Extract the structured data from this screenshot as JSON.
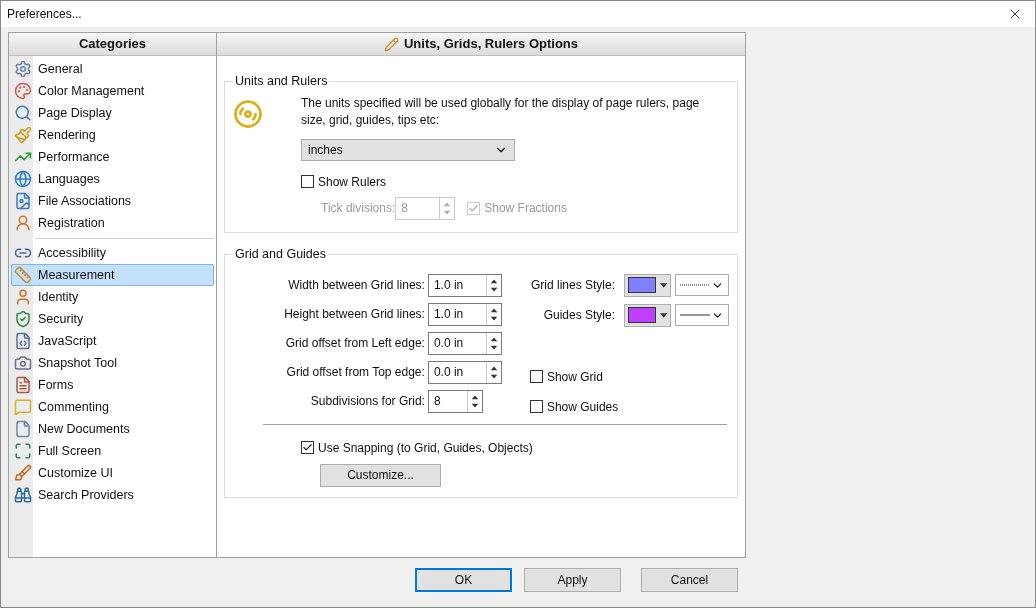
{
  "window": {
    "title": "Preferences..."
  },
  "categories": {
    "title": "Categories",
    "groups": [
      [
        {
          "label": "General",
          "selected": false
        },
        {
          "label": "Color Management",
          "selected": false
        },
        {
          "label": "Page Display",
          "selected": false
        },
        {
          "label": "Rendering",
          "selected": false
        },
        {
          "label": "Performance",
          "selected": false
        },
        {
          "label": "Languages",
          "selected": false
        },
        {
          "label": "File Associations",
          "selected": false
        },
        {
          "label": "Registration",
          "selected": false
        }
      ],
      [
        {
          "label": "Accessibility",
          "selected": false
        },
        {
          "label": "Measurement",
          "selected": true
        },
        {
          "label": "Identity",
          "selected": false
        },
        {
          "label": "Security",
          "selected": false
        },
        {
          "label": "JavaScript",
          "selected": false
        },
        {
          "label": "Snapshot Tool",
          "selected": false
        },
        {
          "label": "Forms",
          "selected": false
        },
        {
          "label": "Commenting",
          "selected": false
        },
        {
          "label": "New Documents",
          "selected": false
        },
        {
          "label": "Full Screen",
          "selected": false
        },
        {
          "label": "Customize UI",
          "selected": false
        },
        {
          "label": "Search Providers",
          "selected": false
        }
      ]
    ]
  },
  "panel": {
    "title": "Units, Grids, Rulers Options"
  },
  "units_and_rulers": {
    "title": "Units and Rulers",
    "description": "The units specified will be used globally for the display of page rulers, page size, grid, guides, tips etc:",
    "units_dropdown": {
      "value": "inches"
    },
    "show_rulers": {
      "label": "Show Rulers",
      "checked": false
    },
    "tick_divisions": {
      "label": "Tick divisions:",
      "value": "8",
      "disabled": true
    },
    "show_fractions": {
      "label": "Show Fractions",
      "checked": true,
      "disabled": true
    }
  },
  "grid_and_guides": {
    "title": "Grid and Guides",
    "spin_fields": [
      {
        "label": "Width between Grid lines:",
        "value": "1.0 in"
      },
      {
        "label": "Height between Grid lines:",
        "value": "1.0 in"
      },
      {
        "label": "Grid offset from Left edge:",
        "value": "0.0 in"
      },
      {
        "label": "Grid offset from Top edge:",
        "value": "0.0 in"
      },
      {
        "label": "Subdivisions for Grid:",
        "value": "8"
      }
    ],
    "styles": [
      {
        "label": "Grid lines Style:",
        "color": "#7f7fff",
        "kind": "dotted"
      },
      {
        "label": "Guides Style:",
        "color": "#bf3fff",
        "kind": "solid"
      }
    ],
    "checkboxes": [
      {
        "label": "Show Grid",
        "checked": false
      },
      {
        "label": "Show Guides",
        "checked": false
      }
    ],
    "use_snapping": {
      "label": "Use Snapping (to Grid, Guides, Objects)",
      "checked": true
    },
    "customize_button": "Customize..."
  },
  "buttons": [
    {
      "label": "OK",
      "default": true
    },
    {
      "label": "Apply",
      "default": false
    },
    {
      "label": "Cancel",
      "default": false
    }
  ]
}
